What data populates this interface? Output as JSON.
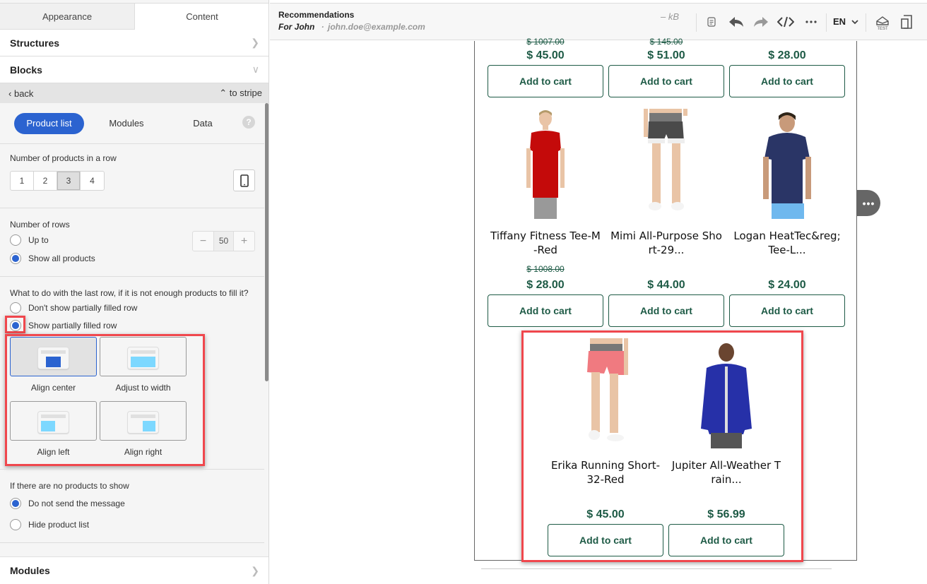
{
  "left_panel": {
    "tabs": [
      {
        "label": "Appearance",
        "active": false
      },
      {
        "label": "Content",
        "active": true
      }
    ],
    "structures_label": "Structures",
    "blocks_label": "Blocks",
    "back_label": "back",
    "to_stripe_label": "to stripe",
    "segments": [
      {
        "label": "Product list",
        "active": true
      },
      {
        "label": "Modules",
        "active": false
      },
      {
        "label": "Data",
        "active": false
      }
    ],
    "help_icon": "?",
    "products_in_row": {
      "label": "Number of products in a row",
      "options": [
        "1",
        "2",
        "3",
        "4"
      ],
      "selected": "3"
    },
    "rows": {
      "label": "Number of rows",
      "options": [
        {
          "label": "Up to",
          "checked": false
        },
        {
          "label": "Show all products",
          "checked": true
        }
      ],
      "stepper_value": "50",
      "minus": "−",
      "plus": "+"
    },
    "last_row": {
      "label": "What to do with the last row, if it is not enough products to fill it?",
      "options": [
        {
          "label": "Don't show partially filled row",
          "checked": false
        },
        {
          "label": "Show partially filled row",
          "checked": true
        }
      ]
    },
    "alignment": [
      {
        "label": "Align center",
        "selected": true
      },
      {
        "label": "Adjust to width",
        "selected": false
      },
      {
        "label": "Align left",
        "selected": false
      },
      {
        "label": "Align right",
        "selected": false
      }
    ],
    "no_products": {
      "label": "If there are no products to show",
      "options": [
        {
          "label": "Do not send the message",
          "checked": true
        },
        {
          "label": "Hide product list",
          "checked": false
        }
      ]
    },
    "modules_label": "Modules"
  },
  "header": {
    "title": "Recommendations",
    "for_label": "For John",
    "email": "john.doe@example.com",
    "size": "– kB",
    "language": "EN",
    "icons": [
      "notes-icon",
      "undo-icon",
      "redo-icon",
      "code-icon",
      "more-icon",
      "test-icon",
      "mobile-preview-icon"
    ]
  },
  "email": {
    "top_row": [
      {
        "old_price": "$ 1007.00",
        "price": "$ 45.00",
        "button": "Add to cart"
      },
      {
        "old_price": "$ 145.00",
        "price": "$ 51.00",
        "button": "Add to cart"
      },
      {
        "old_price": "",
        "price": "$ 28.00",
        "button": "Add to cart"
      }
    ],
    "middle_row": [
      {
        "name_line1": "Tiffany Fitness Tee-M",
        "name_line2": "-Red",
        "old_price": "$ 1008.00",
        "price": "$ 28.00",
        "button": "Add to cart"
      },
      {
        "name_line1": "Mimi All-Purpose Sho",
        "name_line2": "rt-29...",
        "old_price": "",
        "price": "$ 44.00",
        "button": "Add to cart"
      },
      {
        "name_line1": "Logan HeatTec&reg;",
        "name_line2": "Tee-L...",
        "old_price": "",
        "price": "$ 24.00",
        "button": "Add to cart"
      }
    ],
    "last_row": [
      {
        "name_line1": "Erika Running Short-",
        "name_line2": "32-Red",
        "price": "$ 45.00",
        "button": "Add to cart"
      },
      {
        "name_line1": "Jupiter All-Weather T",
        "name_line2": "rain...",
        "price": "$ 56.99",
        "button": "Add to cart"
      }
    ],
    "more_button": "•••"
  },
  "colors": {
    "accent": "#2b63d0",
    "price": "#1d5a45",
    "highlight": "#f0474d",
    "thumb_block": "#7dd8ff"
  }
}
